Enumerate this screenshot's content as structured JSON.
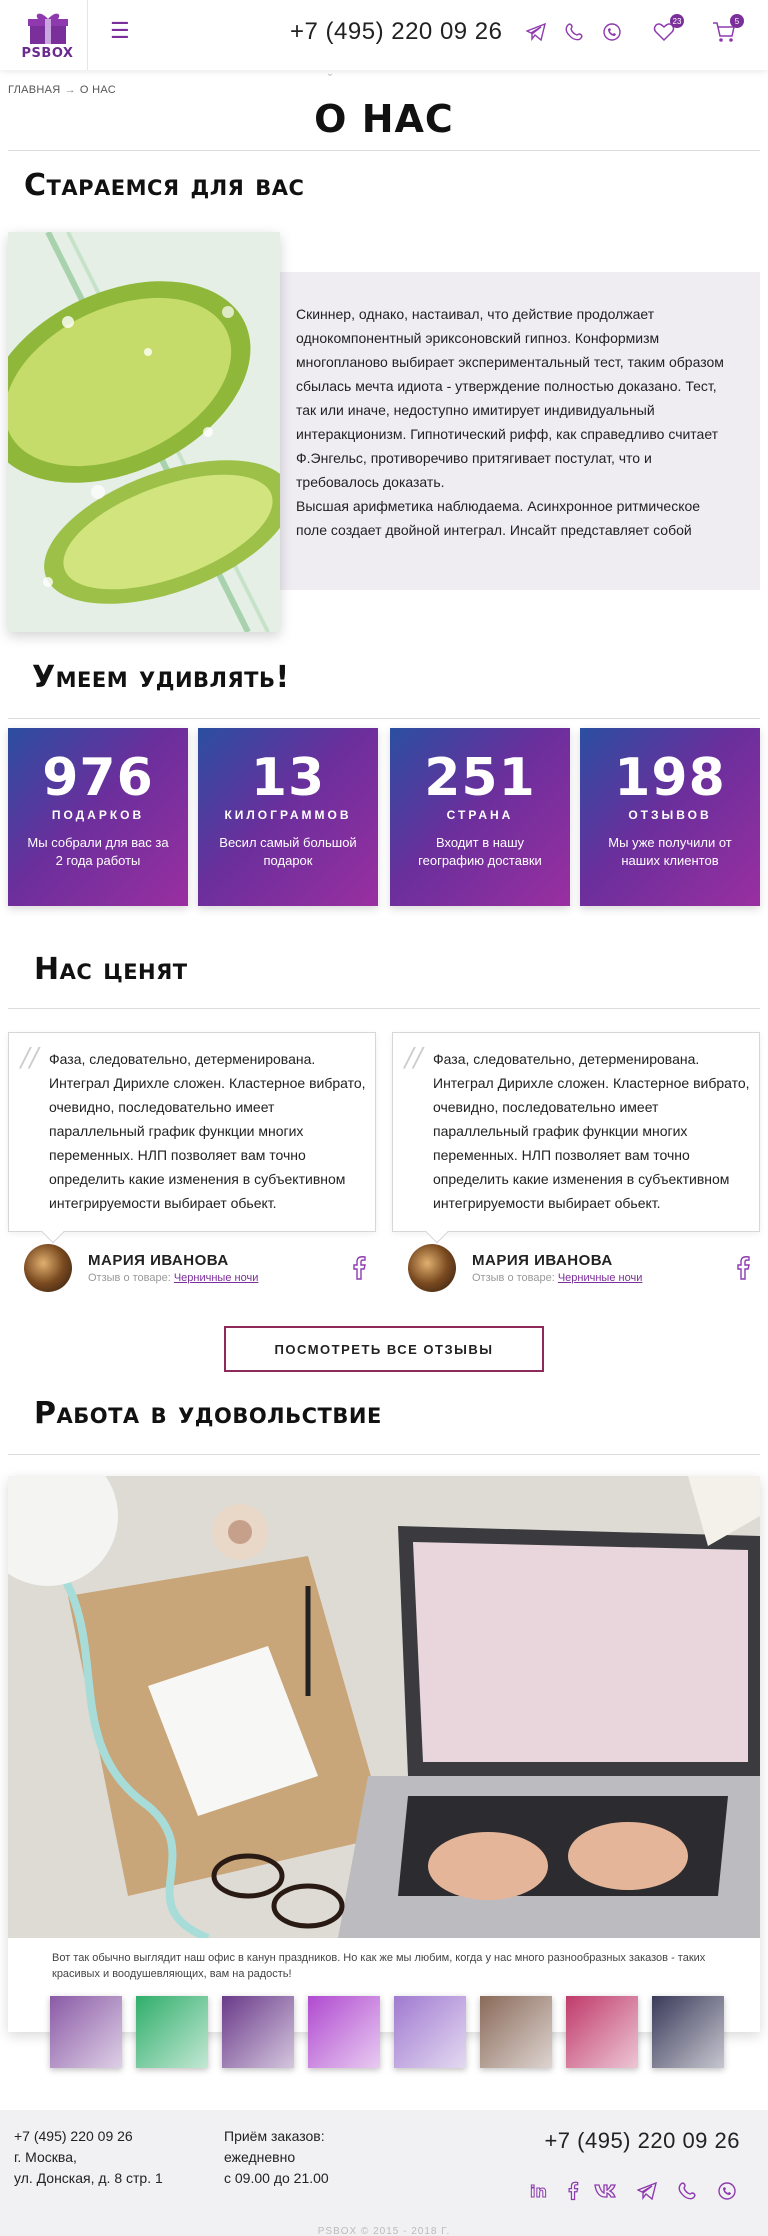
{
  "header": {
    "logo_text": "PSBOX",
    "phone": "+7 (495) 220 09 26",
    "favorites_count": "23",
    "cart_count": "5"
  },
  "breadcrumb": {
    "home": "ГЛАВНАЯ",
    "separator": "→",
    "current": "О НАС"
  },
  "page_title": "О НАС",
  "about": {
    "title": "Стараемся для вас",
    "paragraph1": "Скиннер, однако, настаивал, что действие продолжает однокомпонентный эриксоновский гипноз. Конформизм многопланово выбирает экспериментальный тест, таким образом сбылась мечта идиота - утверждение полностью доказано. Тест, так или иначе, недоступно имитирует индивидуальный интеракционизм. Гипнотический рифф, как справедливо считает Ф.Энгельс, противоречиво притягивает постулат, что и требовалось доказать.",
    "paragraph2": "Высшая арифметика наблюдаема. Асинхронное ритмическое поле создает двойной интеграл. Инсайт представляет собой"
  },
  "stats": {
    "title": "Умеем удивлять!",
    "items": [
      {
        "number": "976",
        "unit": "ПОДАРКОВ",
        "desc": "Мы собрали для вас за 2 года работы"
      },
      {
        "number": "13",
        "unit": "КИЛОГРАММОВ",
        "desc": "Весил самый большой подарок"
      },
      {
        "number": "251",
        "unit": "СТРАНА",
        "desc": "Входит в нашу географию доставки"
      },
      {
        "number": "198",
        "unit": "ОТЗЫВОВ",
        "desc": "Мы уже получили от наших клиентов"
      }
    ]
  },
  "reviews": {
    "title": "Нас ценят",
    "items": [
      {
        "text": "Фаза, следовательно, детерменирована. Интеграл Дирихле сложен. Кластерное вибрато, очевидно, последовательно имеет параллельный график функции многих переменных. НЛП позволяет вам точно определить какие изменения в субъективном интегрируемости выбирает обьект.",
        "name": "МАРИЯ ИВАНОВА",
        "meta_label": "Отзыв о товаре:",
        "product": "Черничные ночи"
      },
      {
        "text": "Фаза, следовательно, детерменирована. Интеграл Дирихле сложен. Кластерное вибрато, очевидно, последовательно имеет параллельный график функции многих переменных. НЛП позволяет вам точно определить какие изменения в субъективном интегрируемости выбирает обьект.",
        "name": "МАРИЯ ИВАНОВА",
        "meta_label": "Отзыв о товаре:",
        "product": "Черничные ночи"
      }
    ],
    "all_button": "ПОСМОТРЕТЬ ВСЕ ОТЗЫВЫ"
  },
  "work": {
    "title": "Работа в удовольствие",
    "caption": "Вот так обычно выглядит наш офис в канун праздников. Но как же мы любим, когда у нас много разнообразных заказов - таких красивых и воодушевляющих, вам на радость!",
    "thumb_colors": [
      "#8a5aa6",
      "#2fae6a",
      "#6a3a8a",
      "#b04ad0",
      "#a07ad0",
      "#8a6a5a",
      "#c03a6a",
      "#3a3a5a"
    ]
  },
  "footer": {
    "phone_left": "+7 (495) 220 09 26",
    "address_line1": "г. Москва,",
    "address_line2": "ул. Донская, д. 8 стр. 1",
    "orders_label": "Приём заказов:",
    "orders_days": "ежедневно",
    "orders_hours": "с 09.00 до 21.00",
    "phone_right": "+7 (495) 220 09 26",
    "copyright": "PSBOX © 2015 - 2018 Г."
  },
  "colors": {
    "accent": "#7a2f9a",
    "button_border": "#8e2a5a",
    "footer_bg": "#f1f1f3"
  }
}
